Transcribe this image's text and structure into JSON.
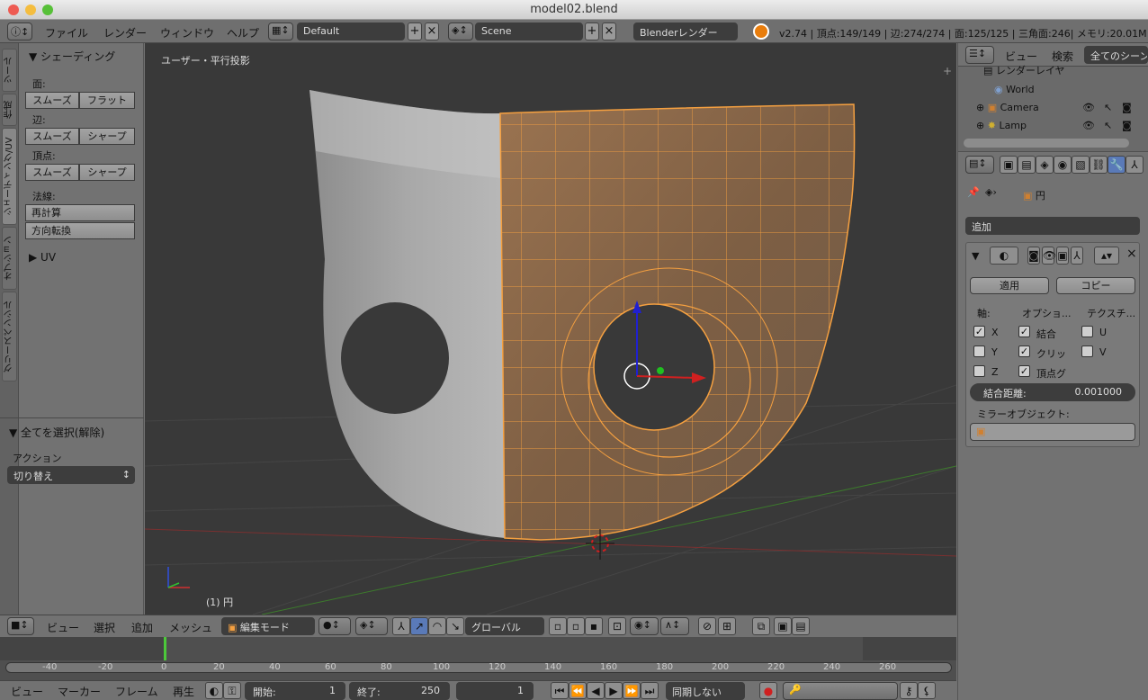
{
  "window": {
    "title": "model02.blend"
  },
  "infobar": {
    "menus": [
      "ファイル",
      "レンダー",
      "ウィンドウ",
      "ヘルプ"
    ],
    "layout": "Default",
    "scene": "Scene",
    "engine": "Blenderレンダー",
    "stats": "v2.74 | 頂点:149/149 | 辺:274/274 | 面:125/125 | 三角面:246| メモリ:20.01M | P"
  },
  "toolshelf": {
    "tabs": [
      "ツール",
      "作成",
      "シェーディング/UV",
      "オプション",
      "グリースペンシル"
    ],
    "shading_title": "▼ シェーディング",
    "face_label": "面:",
    "face_buttons": [
      "スムーズ",
      "フラット"
    ],
    "edge_label": "辺:",
    "edge_buttons": [
      "スムーズ",
      "シャープ"
    ],
    "vertex_label": "頂点:",
    "vertex_buttons": [
      "スムーズ",
      "シャープ"
    ],
    "normals_label": "法線:",
    "recalc": "再計算",
    "flip": "方向転換",
    "uv_title": "▶ UV",
    "operator_title": "▼ 全てを選択(解除)",
    "action_label": "アクション",
    "action_value": "切り替え"
  },
  "viewport": {
    "view_name": "ユーザー・平行投影",
    "object_label": "(1) 円"
  },
  "view3d_header": {
    "menus": [
      "ビュー",
      "選択",
      "追加",
      "メッシュ"
    ],
    "mode": "編集モード",
    "orientation": "グローバル"
  },
  "timeline": {
    "ticks": [
      "-40",
      "-20",
      "0",
      "20",
      "40",
      "60",
      "80",
      "100",
      "120",
      "140",
      "160",
      "180",
      "200",
      "220",
      "240",
      "260"
    ],
    "menus": [
      "ビュー",
      "マーカー",
      "フレーム",
      "再生"
    ],
    "start_label": "開始:",
    "start_value": "1",
    "end_label": "終了:",
    "end_value": "250",
    "current_frame": "1",
    "sync": "同期しない"
  },
  "outliner": {
    "menus": [
      "ビュー",
      "検索"
    ],
    "filter": "全てのシーン",
    "items": [
      "レンダーレイヤ",
      "World",
      "Camera",
      "Lamp"
    ]
  },
  "properties": {
    "breadcrumb_object": "円",
    "add_modifier": "追加",
    "apply": "適用",
    "copy": "コピー",
    "axis_header": "軸:",
    "options_header": "オプショ...",
    "texture_header": "テクスチ...",
    "axes": [
      {
        "label": "X",
        "checked": true
      },
      {
        "label": "Y",
        "checked": false
      },
      {
        "label": "Z",
        "checked": false
      }
    ],
    "options": [
      {
        "label": "結合",
        "checked": true
      },
      {
        "label": "クリッ",
        "checked": true
      },
      {
        "label": "頂点グ",
        "checked": true
      }
    ],
    "textures": [
      {
        "label": "U",
        "checked": false
      },
      {
        "label": "V",
        "checked": false
      }
    ],
    "merge_label": "結合距離:",
    "merge_value": "0.001000",
    "mirror_object_label": "ミラーオブジェクト:"
  },
  "colors": {
    "selection": "#f5a040",
    "mesh_gray": "#9a9a9a",
    "viewport_bg": "#393939"
  }
}
